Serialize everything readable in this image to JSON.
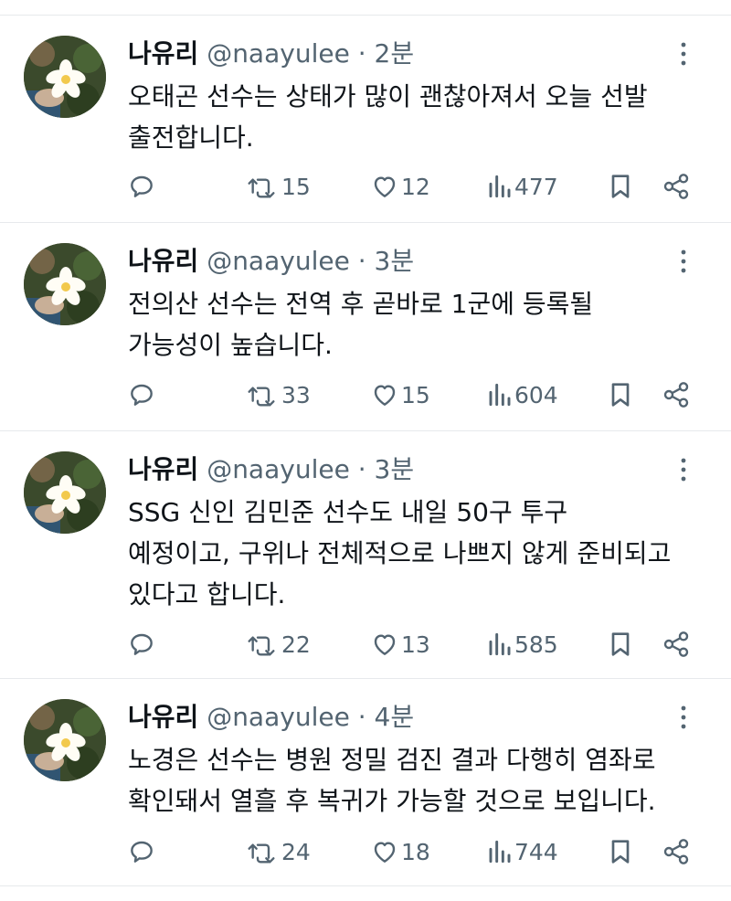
{
  "tweets": [
    {
      "name": "나유리",
      "handle": "@naayulee",
      "separator": "·",
      "time": "2분",
      "text": "오태곤 선수는 상태가 많이 괜찮아져서 오늘 선발\n출전합니다.",
      "retweets": "15",
      "likes": "12",
      "views": "477"
    },
    {
      "name": "나유리",
      "handle": "@naayulee",
      "separator": "·",
      "time": "3분",
      "text": "전의산 선수는 전역 후 곧바로 1군에 등록될\n가능성이 높습니다.",
      "retweets": "33",
      "likes": "15",
      "views": "604"
    },
    {
      "name": "나유리",
      "handle": "@naayulee",
      "separator": "·",
      "time": "3분",
      "text": "SSG 신인 김민준 선수도 내일 50구 투구\n예정이고, 구위나 전체적으로 나쁘지 않게 준비되고\n있다고 합니다.",
      "retweets": "22",
      "likes": "13",
      "views": "585"
    },
    {
      "name": "나유리",
      "handle": "@naayulee",
      "separator": "·",
      "time": "4분",
      "text": "노경은 선수는 병원 정밀 검진 결과 다행히 염좌로\n확인돼서 열흘 후 복귀가 가능할 것으로 보입니다.",
      "retweets": "24",
      "likes": "18",
      "views": "744"
    }
  ],
  "icons": {
    "reply": "reply-icon",
    "retweet": "retweet-icon",
    "like": "heart-icon",
    "views": "views-icon",
    "bookmark": "bookmark-icon",
    "share": "share-icon",
    "more": "more-icon"
  },
  "colors": {
    "text": "#0f1419",
    "secondary": "#536471",
    "divider": "#e7e9ec"
  }
}
